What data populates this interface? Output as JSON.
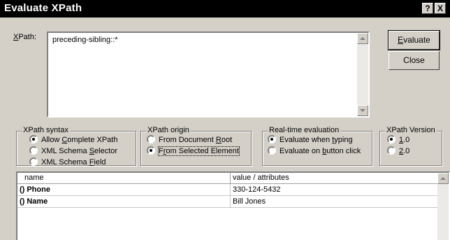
{
  "dialog": {
    "title": "Evaluate XPath",
    "help_label": "?",
    "close_glyph": "X"
  },
  "xpath": {
    "label_mnemonic": "X",
    "label_rest": "Path:",
    "value": "preceding-sibling::*"
  },
  "buttons": {
    "evaluate_mnemonic": "E",
    "evaluate_rest": "valuate",
    "close": "Close"
  },
  "groups": {
    "syntax": {
      "title": "XPath syntax",
      "options": [
        {
          "pre": "Allow ",
          "mn": "C",
          "post": "omplete XPath",
          "selected": true
        },
        {
          "pre": "XML Schema ",
          "mn": "S",
          "post": "elector",
          "selected": false
        },
        {
          "pre": "XML Schema ",
          "mn": "F",
          "post": "ield",
          "selected": false
        }
      ]
    },
    "origin": {
      "title": "XPath origin",
      "options": [
        {
          "pre": "From Document ",
          "mn": "R",
          "post": "oot",
          "selected": false
        },
        {
          "pre": "F",
          "mn": "r",
          "post": "om Selected Element",
          "selected": true
        }
      ]
    },
    "realtime": {
      "title": "Real-time evaluation",
      "options": [
        {
          "pre": "Evaluate when ",
          "mn": "t",
          "post": "yping",
          "selected": true
        },
        {
          "pre": "Evaluate on ",
          "mn": "b",
          "post": "utton click",
          "selected": false
        }
      ]
    },
    "version": {
      "title": "XPath Version",
      "options": [
        {
          "pre": "",
          "mn": "1",
          "post": ".0",
          "selected": true
        },
        {
          "pre": "",
          "mn": "2",
          "post": ".0",
          "selected": false
        }
      ]
    }
  },
  "results": {
    "columns": [
      "name",
      "value / attributes"
    ],
    "rows": [
      {
        "icon": "()",
        "name": "Phone",
        "value": "330-124-5432"
      },
      {
        "icon": "()",
        "name": "Name",
        "value": "Bill Jones"
      }
    ]
  }
}
